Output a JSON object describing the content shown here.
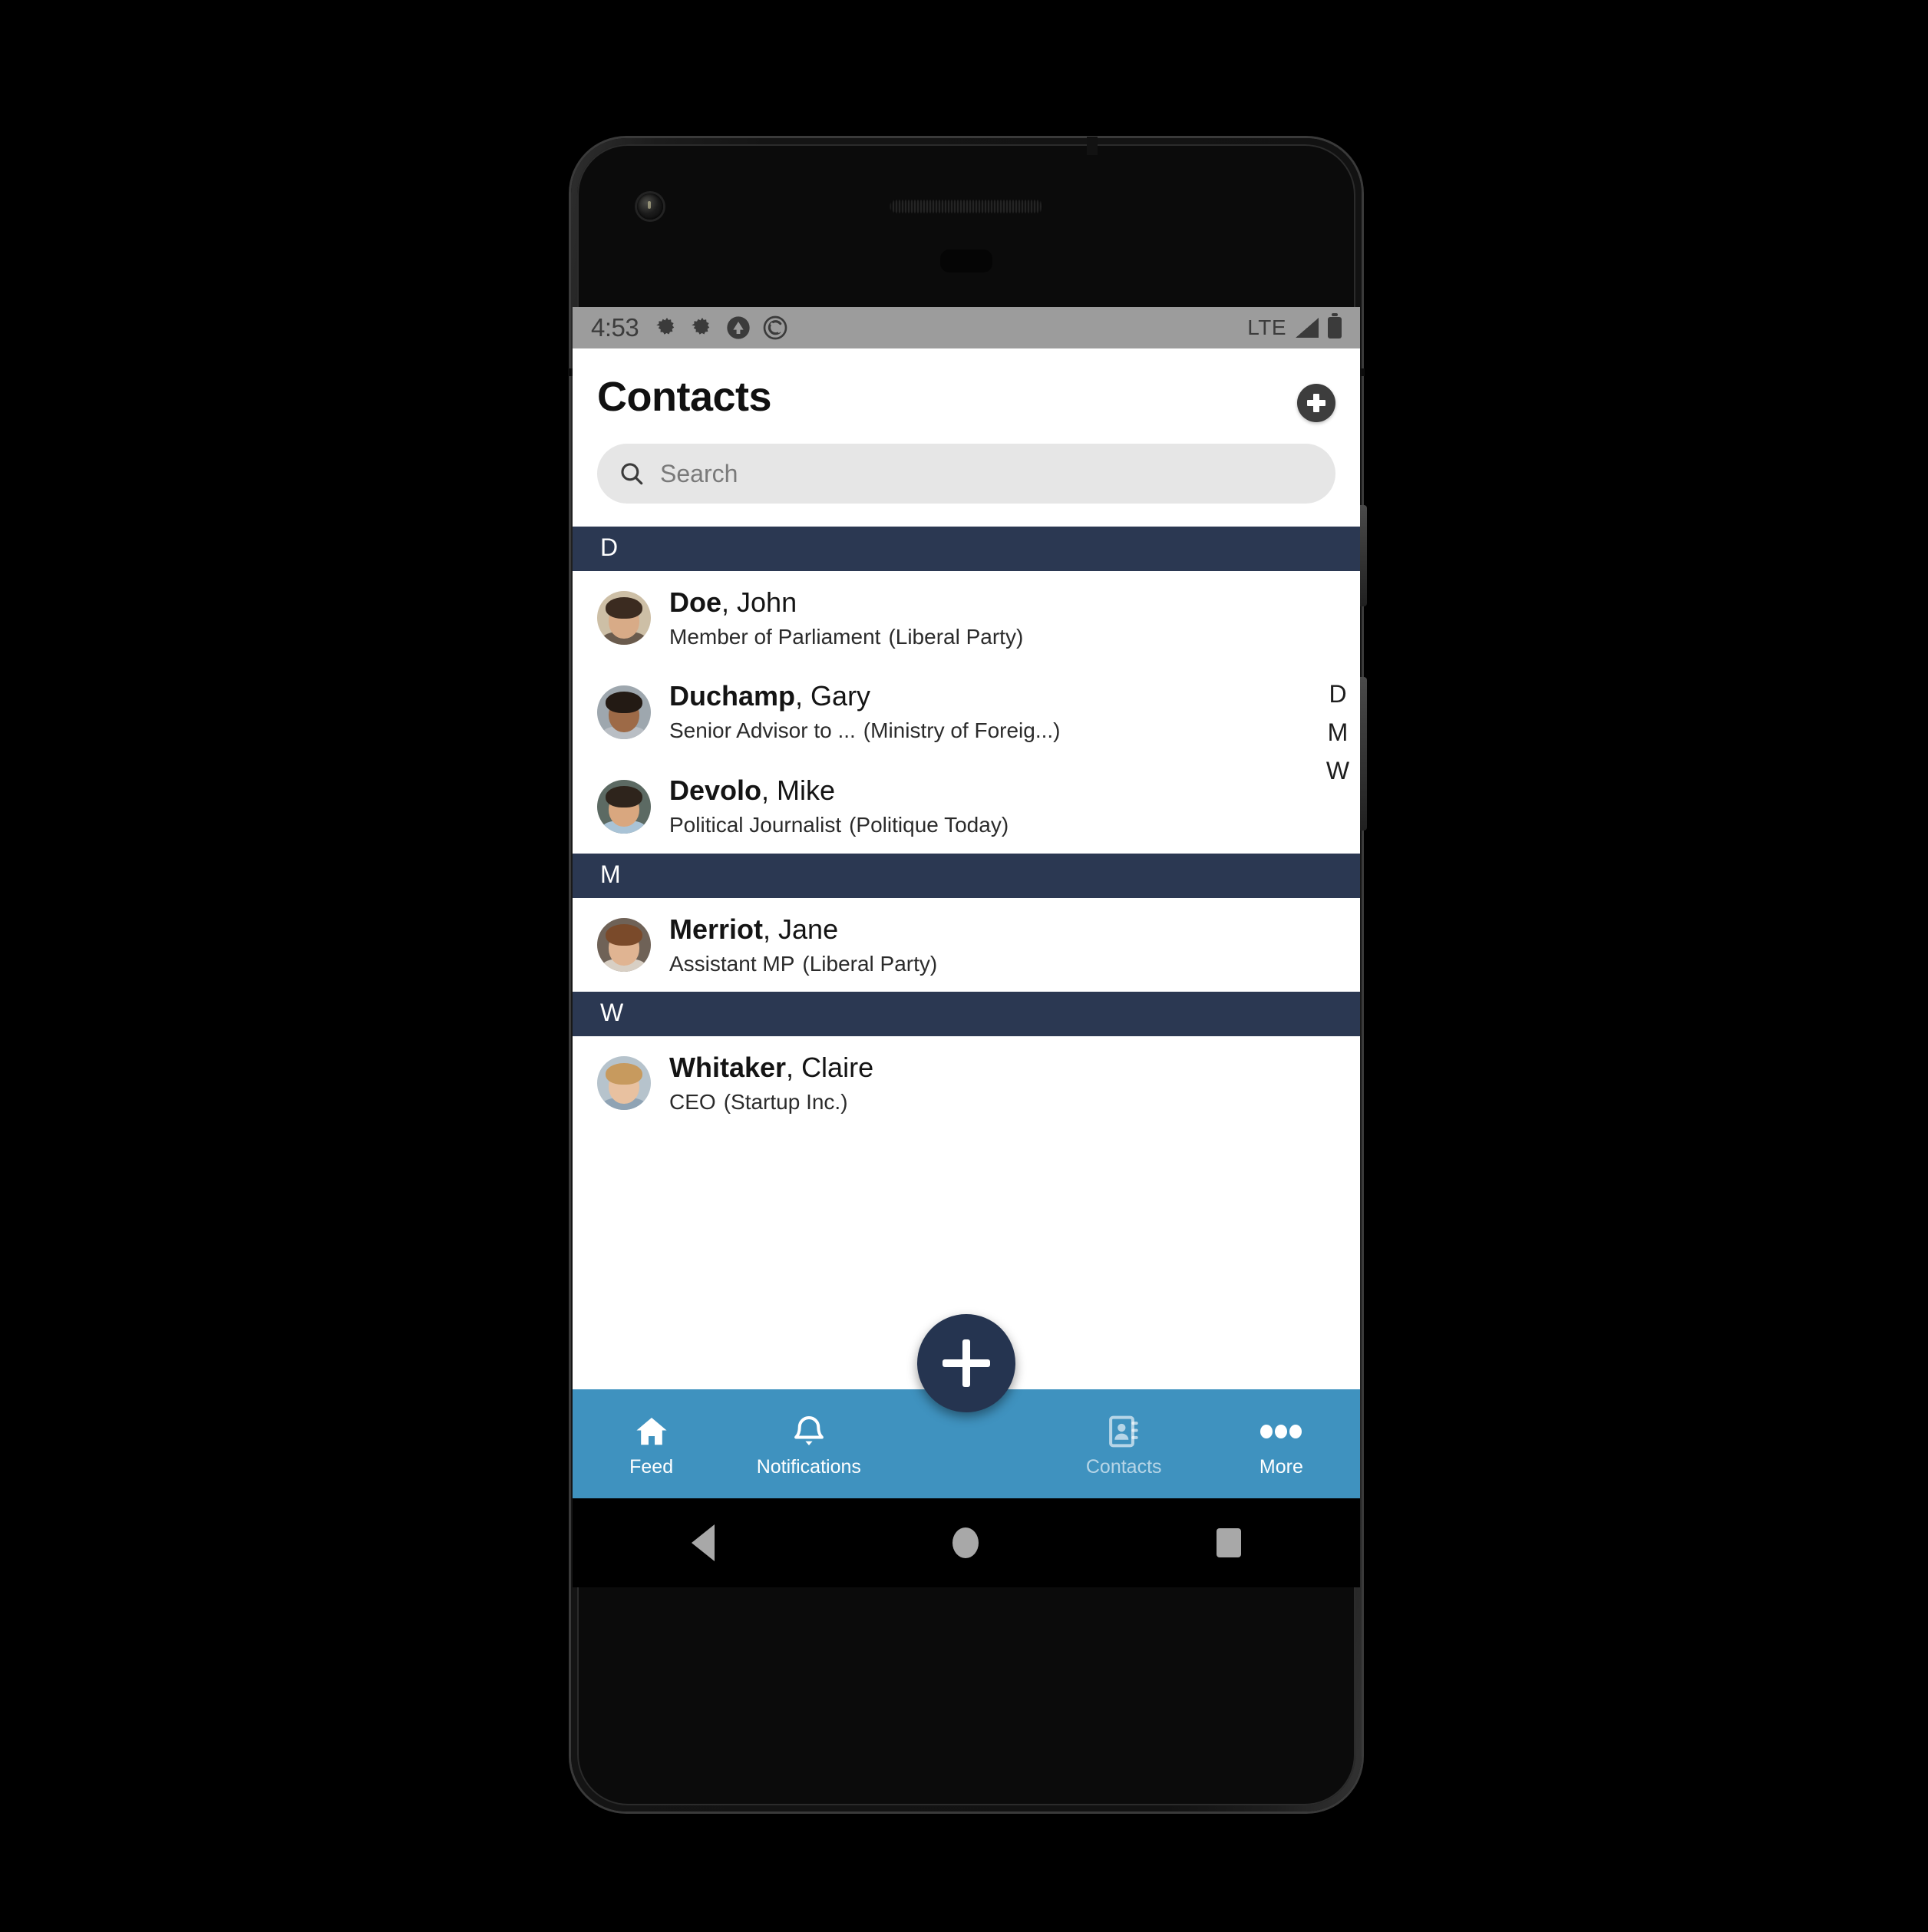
{
  "status_bar": {
    "time": "4:53",
    "left_icons": [
      "gear-icon",
      "gear-icon",
      "chevron-up-circle-icon",
      "no-sync-circle-icon"
    ],
    "network": "LTE",
    "right_icons": [
      "signal-icon",
      "battery-icon"
    ]
  },
  "header": {
    "title": "Contacts",
    "add_button_icon": "plus-circle-icon"
  },
  "search": {
    "placeholder": "Search",
    "value": "",
    "icon": "search-icon"
  },
  "alpha_index": {
    "letters": [
      "D",
      "M",
      "W"
    ]
  },
  "sections": [
    {
      "letter": "D",
      "contacts": [
        {
          "last_name": "Doe",
          "first_name": "John",
          "role": "Member of Parliament",
          "organization": "(Liberal Party)",
          "avatar": {
            "skin": "#d8ab87",
            "hair": "#3b2b20",
            "bg": "#cdbfa6",
            "shirt": "#6a5b4d"
          }
        },
        {
          "last_name": "Duchamp",
          "first_name": "Gary",
          "role": "Senior Advisor to ...",
          "organization": "(Ministry of Foreig...)",
          "avatar": {
            "skin": "#9d6a47",
            "hair": "#231a14",
            "bg": "#9ea7ae",
            "shirt": "#b9bec4"
          }
        },
        {
          "last_name": "Devolo",
          "first_name": "Mike",
          "role": "Political Journalist",
          "organization": "(Politique Today)",
          "avatar": {
            "skin": "#d9a77f",
            "hair": "#2e241c",
            "bg": "#5c6a63",
            "shirt": "#a9c3d6"
          }
        }
      ]
    },
    {
      "letter": "M",
      "contacts": [
        {
          "last_name": "Merriot",
          "first_name": "Jane",
          "role": "Assistant MP",
          "organization": "(Liberal Party)",
          "avatar": {
            "skin": "#e0b492",
            "hair": "#7a4a2a",
            "bg": "#6f6257",
            "shirt": "#d8cfc4"
          }
        }
      ]
    },
    {
      "letter": "W",
      "contacts": [
        {
          "last_name": "Whitaker",
          "first_name": "Claire",
          "role": "CEO",
          "organization": "(Startup Inc.)",
          "avatar": {
            "skin": "#e8c1a0",
            "hair": "#c79a5e",
            "bg": "#b6c3cc",
            "shirt": "#8fa3b4"
          }
        }
      ]
    }
  ],
  "fab": {
    "icon": "plus-icon"
  },
  "bottom_nav": {
    "items": [
      {
        "label": "Feed",
        "icon": "home-icon",
        "active": false
      },
      {
        "label": "Notifications",
        "icon": "bell-icon",
        "active": false
      },
      {
        "label": "Contacts",
        "icon": "contact-book-icon",
        "active": true
      },
      {
        "label": "More",
        "icon": "ellipsis-icon",
        "active": false
      }
    ]
  },
  "android_nav": {
    "buttons": [
      "back-button",
      "home-button",
      "recents-button"
    ]
  },
  "colors": {
    "section_header": "#2b3852",
    "bottom_nav": "#3f92bf",
    "fab": "#253450",
    "search_field": "#e6e6e6",
    "status_bar": "#9c9c9c"
  }
}
